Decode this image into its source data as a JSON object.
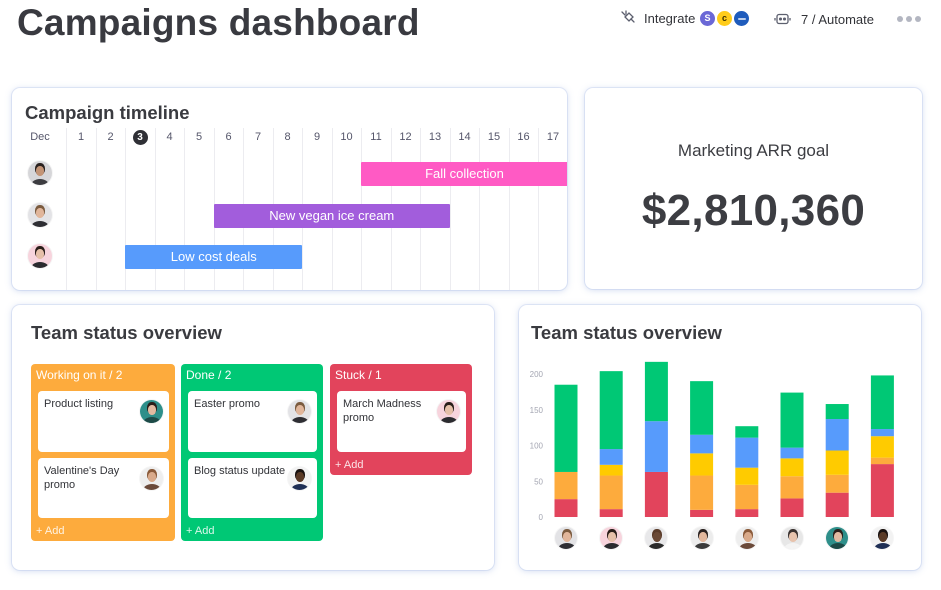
{
  "header": {
    "title": "Campaigns dashboard",
    "integrate_label": "Integrate",
    "integrate_icon": "plug-icon",
    "integration_logos": [
      {
        "name": "s-app-logo",
        "glyph": "S",
        "color": "#6b68d6",
        "text_color": "#ffffff"
      },
      {
        "name": "c-app-logo",
        "glyph": "c",
        "color": "#ffcc1a",
        "text_color": "#3a2e00"
      },
      {
        "name": "blue-app-logo",
        "glyph": "",
        "color": "#1f5cbc",
        "text_color": "#ffffff"
      }
    ],
    "automate_icon": "robot-icon",
    "automate_label": "7 / Automate",
    "more_icon": "more-dots-icon"
  },
  "people": [
    {
      "bg": "#d6d6d9",
      "skin": "#c39476",
      "hair": "#2a2220",
      "shirt": "#3c3c40"
    },
    {
      "bg": "#e3e3e6",
      "skin": "#e1b69b",
      "hair": "#7b5b3f",
      "shirt": "#2e2e33"
    },
    {
      "bg": "#f7d4dd",
      "skin": "#e6c0a9",
      "hair": "#2a1e1a",
      "shirt": "#2b2b2f"
    },
    {
      "bg": "#2e8f8a",
      "skin": "#e2baa1",
      "hair": "#2b1f1a",
      "shirt": "#1d4a47"
    },
    {
      "bg": "#eeeeee",
      "skin": "#d9aa8b",
      "hair": "#8a5a3a",
      "shirt": "#6b4a3a"
    },
    {
      "bg": "#f2f2f2",
      "skin": "#5a3a26",
      "hair": "#1a1210",
      "shirt": "#1f2f55"
    },
    {
      "bg": "#e8e8ea",
      "skin": "#6b4a36",
      "hair": "#5a3c2a",
      "shirt": "#2a2a2a"
    },
    {
      "bg": "#ececec",
      "skin": "#e2b79c",
      "hair": "#2a2220",
      "shirt": "#3b3b3b"
    },
    {
      "bg": "#e7e7e7",
      "skin": "#e7c3ad",
      "hair": "#3a3230",
      "shirt": "#f4f4f4"
    }
  ],
  "timeline": {
    "title": "Campaign timeline",
    "month": "Dec",
    "days": [
      1,
      2,
      3,
      4,
      5,
      6,
      7,
      8,
      9,
      10,
      11,
      12,
      13,
      14,
      15,
      16,
      17
    ],
    "today": 3,
    "rows": [
      {
        "person": 0,
        "bar": {
          "label": "Fall collection",
          "start": 11,
          "end": 17,
          "color": "#ff5ac4"
        }
      },
      {
        "person": 1,
        "bar": {
          "label": "New vegan ice cream",
          "start": 6,
          "end": 13,
          "color": "#a25ddc"
        }
      },
      {
        "person": 2,
        "bar": {
          "label": "Low cost deals",
          "start": 3,
          "end": 8,
          "color": "#579bfc"
        }
      }
    ]
  },
  "arr": {
    "label": "Marketing ARR goal",
    "value": "$2,810,360"
  },
  "kanban": {
    "title": "Team status overview",
    "columns": [
      {
        "label": "Working on it / 2",
        "color": "#fdab3d",
        "add_label": "+ Add",
        "items": [
          {
            "title": "Product listing",
            "person": 3
          },
          {
            "title": "Valentine's Day promo",
            "person": 4
          }
        ]
      },
      {
        "label": "Done / 2",
        "color": "#00c875",
        "add_label": "+ Add",
        "items": [
          {
            "title": "Easter promo",
            "person": 1
          },
          {
            "title": "Blog status update",
            "person": 5
          }
        ]
      },
      {
        "label": "Stuck / 1",
        "color": "#e2445c",
        "add_label": "+ Add",
        "items": [
          {
            "title": "March Madness promo",
            "person": 2
          }
        ]
      }
    ]
  },
  "chart_data": {
    "type": "bar",
    "stacked": true,
    "title": "Team status overview",
    "xlabel": "",
    "ylabel": "",
    "ylim": [
      0,
      200
    ],
    "yticks": [
      0,
      50,
      100,
      150,
      200
    ],
    "grid": false,
    "legend": "none",
    "x_people": [
      1,
      2,
      6,
      7,
      4,
      8,
      3,
      5
    ],
    "series": [
      {
        "name": "red",
        "color": "#e2445c",
        "values": [
          25,
          11,
          63,
          10,
          11,
          26,
          34,
          74
        ]
      },
      {
        "name": "orange",
        "color": "#fdab3d",
        "values": [
          38,
          47,
          0,
          48,
          34,
          31,
          25,
          9
        ]
      },
      {
        "name": "yellow",
        "color": "#ffcb00",
        "values": [
          0,
          15,
          0,
          31,
          24,
          25,
          34,
          30
        ]
      },
      {
        "name": "blue",
        "color": "#579bfc",
        "values": [
          0,
          22,
          71,
          26,
          42,
          15,
          44,
          10
        ]
      },
      {
        "name": "green",
        "color": "#00c875",
        "values": [
          122,
          109,
          83,
          75,
          16,
          77,
          21,
          75
        ]
      }
    ]
  }
}
